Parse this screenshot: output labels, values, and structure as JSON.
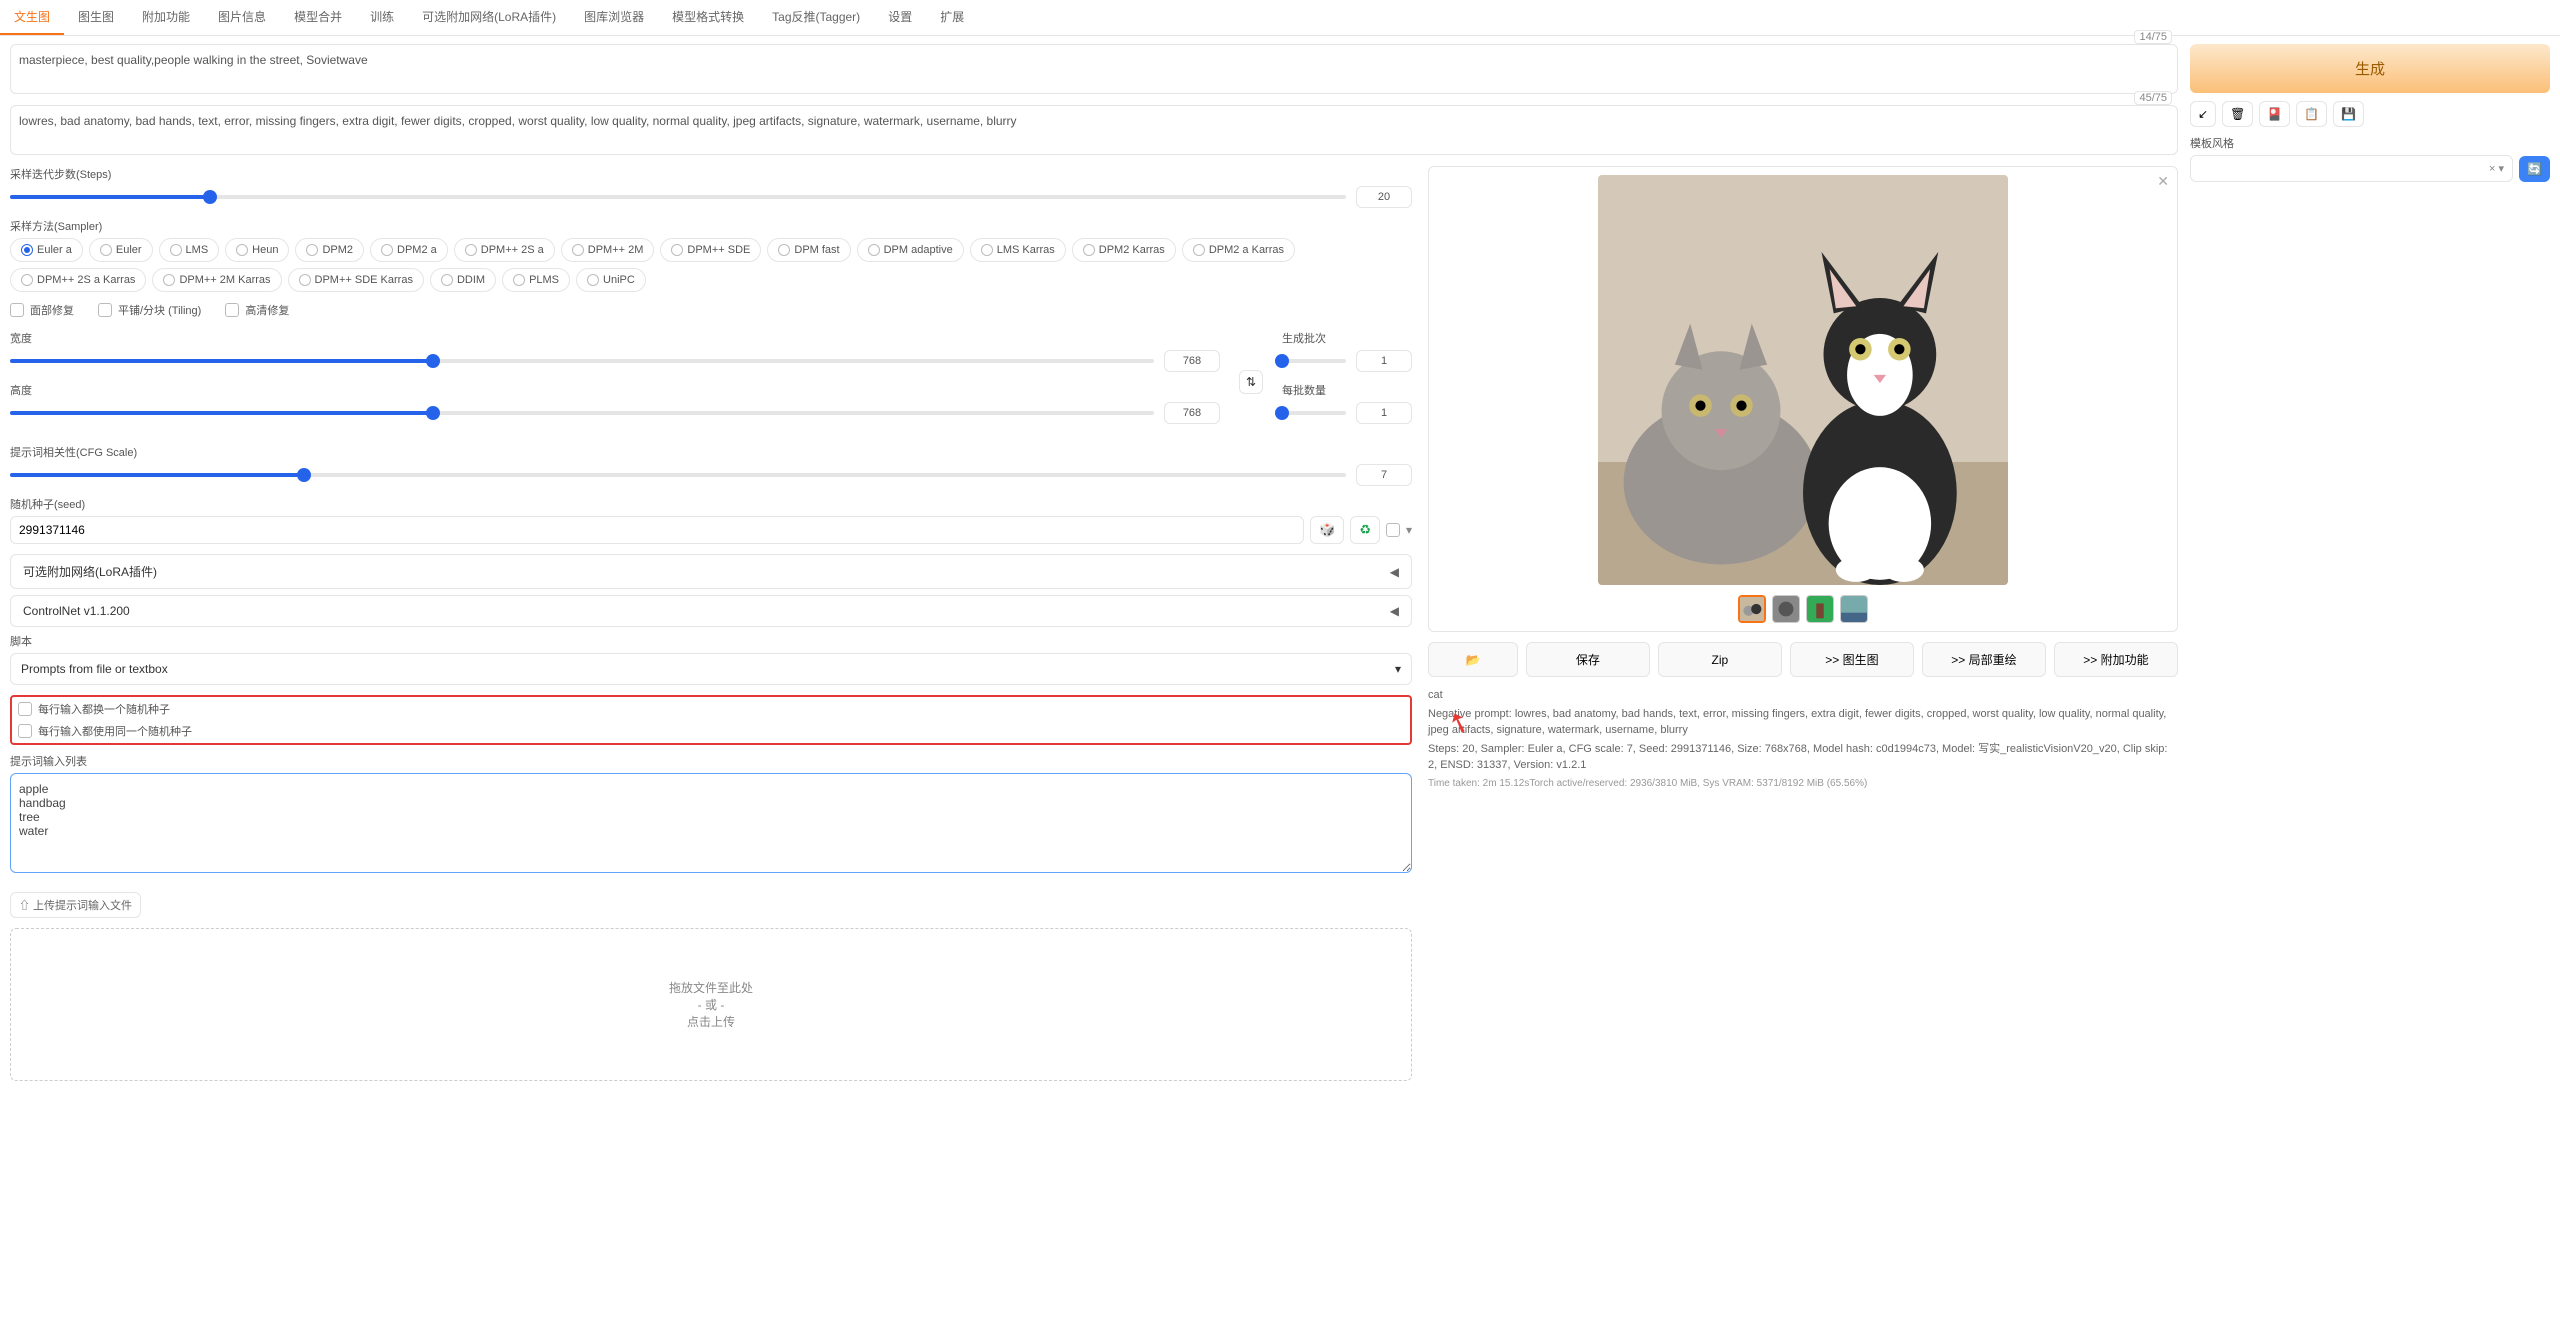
{
  "tabs": [
    "文生图",
    "图生图",
    "附加功能",
    "图片信息",
    "模型合并",
    "训练",
    "可选附加网络(LoRA插件)",
    "图库浏览器",
    "模型格式转换",
    "Tag反推(Tagger)",
    "设置",
    "扩展"
  ],
  "active_tab": 0,
  "prompt": {
    "token": "14/75",
    "text": "masterpiece, best quality,people walking in the street, Sovietwave"
  },
  "neg_prompt": {
    "token": "45/75",
    "text": "lowres, bad anatomy, bad hands, text, error, missing fingers, extra digit, fewer digits, cropped, worst quality, low quality, normal quality, jpeg artifacts, signature, watermark, username, blurry"
  },
  "steps": {
    "label": "采样迭代步数(Steps)",
    "value": 20,
    "pct": "15%"
  },
  "sampler": {
    "label": "采样方法(Sampler)",
    "options": [
      "Euler a",
      "Euler",
      "LMS",
      "Heun",
      "DPM2",
      "DPM2 a",
      "DPM++ 2S a",
      "DPM++ 2M",
      "DPM++ SDE",
      "DPM fast",
      "DPM adaptive",
      "LMS Karras",
      "DPM2 Karras",
      "DPM2 a Karras",
      "DPM++ 2S a Karras",
      "DPM++ 2M Karras",
      "DPM++ SDE Karras",
      "DDIM",
      "PLMS",
      "UniPC"
    ],
    "selected": "Euler a"
  },
  "checks": {
    "face": "面部修复",
    "tiling": "平铺/分块 (Tiling)",
    "hires": "高清修复"
  },
  "width": {
    "label": "宽度",
    "value": 768,
    "pct": "37%"
  },
  "height": {
    "label": "高度",
    "value": 768,
    "pct": "37%"
  },
  "batch_count": {
    "label": "生成批次",
    "value": 1,
    "pct": "0%"
  },
  "batch_size": {
    "label": "每批数量",
    "value": 1,
    "pct": "0%"
  },
  "cfg": {
    "label": "提示词相关性(CFG Scale)",
    "value": 7,
    "pct": "22%"
  },
  "seed": {
    "label": "随机种子(seed)",
    "value": "2991371146"
  },
  "accordions": {
    "lora": "可选附加网络(LoRA插件)",
    "controlnet": "ControlNet v1.1.200"
  },
  "script": {
    "label": "脚本",
    "value": "Prompts from file or textbox"
  },
  "script_opts": {
    "iterate_seed": "每行输入都换一个随机种子",
    "same_seed": "每行输入都使用同一个随机种子"
  },
  "prompt_list": {
    "label": "提示词输入列表",
    "value": "apple\nhandbag\ntree\nwater"
  },
  "upload_label": "⇧ 上传提示词输入文件",
  "dropzone": {
    "l1": "拖放文件至此处",
    "l2": "- 或 -",
    "l3": "点击上传"
  },
  "generate": "生成",
  "style_label": "模板风格",
  "actions": {
    "folder": "📂",
    "save": "保存",
    "zip": "Zip",
    "img2img": ">> 图生图",
    "inpaint": ">> 局部重绘",
    "extras": ">> 附加功能"
  },
  "info": {
    "l1": "cat",
    "l2": "Negative prompt: lowres, bad anatomy, bad hands, text, error, missing fingers, extra digit, fewer digits, cropped, worst quality, low quality, normal quality, jpeg artifacts, signature, watermark, username, blurry",
    "l3": "Steps: 20, Sampler: Euler a, CFG scale: 7, Seed: 2991371146, Size: 768x768, Model hash: c0d1994c73, Model: 写实_realisticVisionV20_v20, Clip skip: 2, ENSD: 31337, Version: v1.2.1",
    "l4": "Time taken: 2m 15.12sTorch active/reserved: 2936/3810 MiB, Sys VRAM: 5371/8192 MiB (65.56%)"
  }
}
